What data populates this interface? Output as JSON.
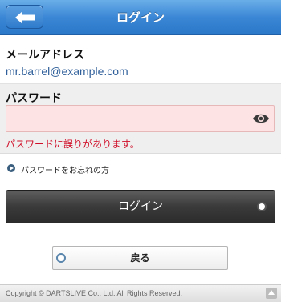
{
  "header": {
    "title": "ログイン",
    "back_icon": "back-arrow-icon",
    "accent_color": "#3b87d6"
  },
  "email": {
    "label": "メールアドレス",
    "value": "mr.barrel@example.com"
  },
  "password": {
    "label": "パスワード",
    "value": "",
    "visibility_icon": "eye-icon",
    "error": "パスワードに誤りがあります。",
    "error_color": "#d0102a"
  },
  "forgot": {
    "label": "パスワードをお忘れの方",
    "icon": "arrow-bullet-icon"
  },
  "login_button": {
    "label": "ログイン"
  },
  "back_button": {
    "label": "戻る"
  },
  "footer": {
    "copyright": "Copyright © DARTSLIVE Co., Ltd. All Rights Reserved.",
    "top_icon": "scroll-top-icon"
  }
}
